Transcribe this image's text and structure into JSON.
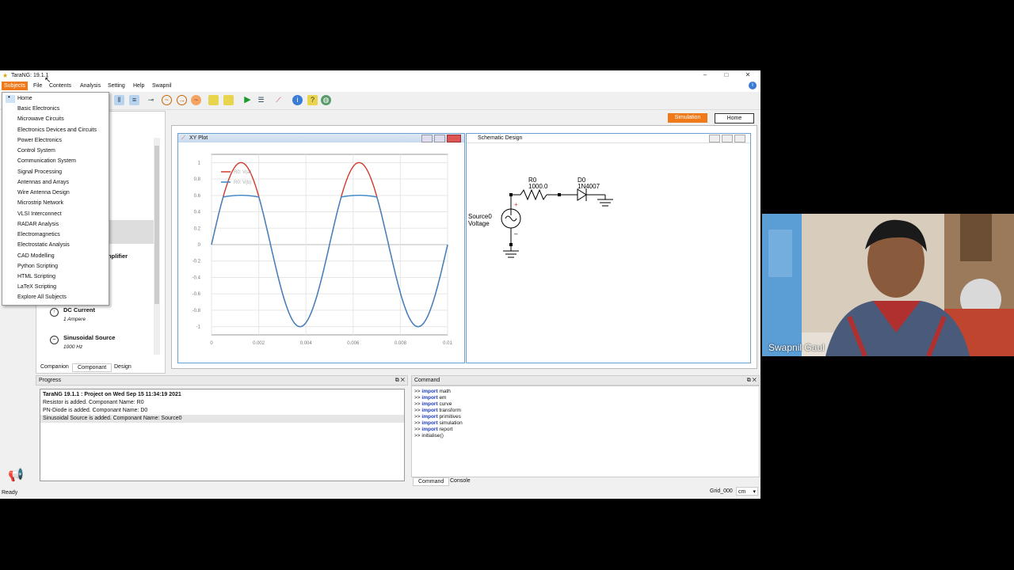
{
  "window": {
    "title": "TaraNG: 19.1.1",
    "min": "–",
    "max": "□",
    "close": "✕"
  },
  "menu": [
    "Subjects",
    "File",
    "Contents",
    "Analysis",
    "Setting",
    "Help",
    "Swapnil"
  ],
  "subjects_dropdown": [
    "Home",
    "Basic Electronics",
    "Microwave Circuits",
    "Electronics Devices and Circuits",
    "Power Electronics",
    "Control System",
    "Communication System",
    "Signal Processing",
    "Antennas and Arrays",
    "Wire Antenna Design",
    "Microstrip Network",
    "VLSI Interconnect",
    "RADAR Analysis",
    "Electromagnetics",
    "Electrostatic Analysis",
    "CAD Modelling",
    "Python Scripting",
    "HTML Scripting",
    "LaTeX Scripting",
    "Explore All Subjects"
  ],
  "header_buttons": {
    "simulation": "Simulation",
    "home": "Home"
  },
  "component_list": [
    {
      "name": "mplifier",
      "sub": ""
    },
    {
      "name": "DC Current",
      "sub": "1 Ampere"
    },
    {
      "name": "Sinusoidal Source",
      "sub": "1000 Hz"
    }
  ],
  "left_tabs": [
    "Companion",
    "Componant",
    "Design"
  ],
  "xy_plot": {
    "title": "XY Plot",
    "legend": [
      "R0: V(a)",
      "R0: V(b)"
    ]
  },
  "schematic": {
    "title": "Schematic Design",
    "r_name": "R0",
    "r_value": "1000.0",
    "d_name": "D0",
    "d_value": "1N4007",
    "src_name": "Source0",
    "src_type": "Voltage",
    "plus": "+",
    "minus": "–"
  },
  "chart_data": {
    "type": "line",
    "x_ticks": [
      "0",
      "0.002",
      "0.004",
      "0.006",
      "0.008",
      "0.01"
    ],
    "y_ticks": [
      "1",
      "0.8",
      "0.6",
      "0.4",
      "0.2",
      "0",
      "-0.2",
      "-0.4",
      "-0.6",
      "-0.8",
      "-1"
    ],
    "xlim": [
      0,
      0.01
    ],
    "ylim": [
      -1.1,
      1.1
    ],
    "series": [
      {
        "name": "R0: V(a)",
        "color": "#d23a2a",
        "kind": "sine",
        "amp": 1,
        "freq": 200
      },
      {
        "name": "R0: V(b)",
        "color": "#3a86c8",
        "kind": "clipped-sine",
        "amp": 1,
        "freq": 200,
        "clip": 0.58
      }
    ]
  },
  "progress": {
    "title": "Progress",
    "lines": [
      "TaraNG 19.1.1 : Project on Wed Sep 15 11:34:19 2021",
      "Resistor is added. Componant Name: R0",
      "PN-Diode is added. Componant Name: D0",
      "Sinusoidal Source is added. Componant Name: Source0"
    ]
  },
  "command": {
    "title": "Command",
    "lines": [
      {
        "prompt": ">> ",
        "kw": "import",
        "rest": " math"
      },
      {
        "prompt": ">> ",
        "kw": "import",
        "rest": " em"
      },
      {
        "prompt": ">> ",
        "kw": "import",
        "rest": " curve"
      },
      {
        "prompt": ">> ",
        "kw": "import",
        "rest": " transform"
      },
      {
        "prompt": ">> ",
        "kw": "import",
        "rest": " primitives"
      },
      {
        "prompt": ">> ",
        "kw": "import",
        "rest": " simulation"
      },
      {
        "prompt": ">> ",
        "kw": "import",
        "rest": " report"
      },
      {
        "prompt": ">> ",
        "kw": "",
        "rest": "initialise()"
      }
    ],
    "tabs": [
      "Command",
      "Console"
    ]
  },
  "status": {
    "ready": "Ready",
    "grid": "Grid_000",
    "unit": "cm"
  },
  "webcam": {
    "name": "Swapnil Gaul"
  },
  "colors": {
    "accent": "#f07a1a",
    "plot_red": "#d23a2a",
    "plot_blue": "#3a86c8"
  }
}
